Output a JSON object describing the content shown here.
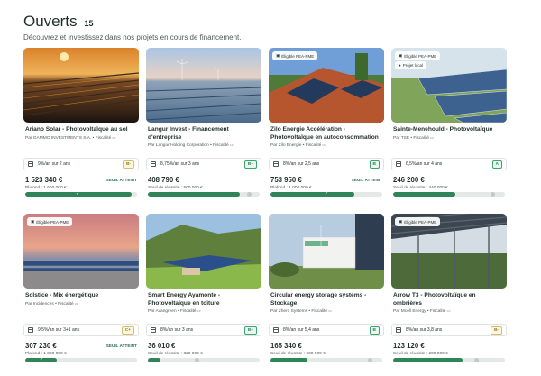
{
  "page": {
    "title": "Ouverts",
    "count": "15",
    "subtitle": "Découvrez et investissez dans nos projets en cours de financement."
  },
  "projects": [
    {
      "name": "Ariano Solar - Photovoltaïque au sol",
      "by": "Par GAMMO INVESTMENTS S.A. • Fiscalité",
      "rate": "9%/an sur 2 ans",
      "grade": "B-",
      "amount": "1 523 340 €",
      "status": "SEUIL ATTEINT",
      "goal": "Plafond : 1 600 000 €",
      "progress": 0.95,
      "tags": []
    },
    {
      "name": "Langur Invest - Financement d'entreprise",
      "by": "Par Langur Holding Corporation • Fiscalité",
      "rate": "8,75%/an sur 3 ans",
      "grade": "B+",
      "amount": "408 790 €",
      "status": "",
      "goal": "Seuil de réussite : 500 000 €",
      "progress": 0.82,
      "tags": []
    },
    {
      "name": "Zilo Energie Accélération - Photovoltaïque en autoconsommation",
      "by": "Par Zilo Energie • Fiscalité",
      "rate": "8%/an sur 2,5 ans",
      "grade": "B",
      "amount": "753 950 €",
      "status": "SEUIL ATTEINT",
      "goal": "Plafond : 1 000 000 €",
      "progress": 0.75,
      "tags": [
        "Éligible PEA-PME"
      ]
    },
    {
      "name": "Sainte-Menehould - Photovoltaïque",
      "by": "Par TSE • Fiscalité",
      "rate": "6,5%/an sur 4 ans",
      "grade": "A",
      "amount": "246 200 €",
      "status": "",
      "goal": "Seuil de réussite : 440 000 €",
      "progress": 0.56,
      "tags": [
        "Éligible PEA-PME",
        "Projet local"
      ]
    },
    {
      "name": "Solstice - Mix énergétique",
      "by": "Par Incidences • Fiscalité",
      "rate": "9,5%/an sur 3+1 ans",
      "grade": "C+",
      "amount": "307 230 €",
      "status": "SEUIL ATTEINT",
      "goal": "Plafond : 1 080 000 €",
      "progress": 0.28,
      "tags": [
        "Éligible PEA-PME"
      ]
    },
    {
      "name": "Smart Energy Ayamonte - Photovoltaïque en toiture",
      "by": "Par Avangreen • Fiscalité",
      "rate": "8%/an sur 3 ans",
      "grade": "B+",
      "amount": "36 010 €",
      "status": "",
      "goal": "Seuil de réussite : 320 000 €",
      "progress": 0.11,
      "tags": []
    },
    {
      "name": "Circular energy storage systems - Stockage",
      "by": "Par Zhero Systems • Fiscalité",
      "rate": "8%/an sur 5,4 ans",
      "grade": "B",
      "amount": "165 340 €",
      "status": "",
      "goal": "Seuil de réussite : 500 000 €",
      "progress": 0.33,
      "tags": []
    },
    {
      "name": "Arrow T3 - Photovoltaïque en ombrières",
      "by": "Par Mcell Energy • Fiscalité",
      "rate": "8%/an sur 3,8 ans",
      "grade": "B-",
      "amount": "123 120 €",
      "status": "",
      "goal": "Seuil de réussite : 200 000 €",
      "progress": 0.62,
      "tags": [
        "Éligible PEA-PME"
      ]
    }
  ]
}
